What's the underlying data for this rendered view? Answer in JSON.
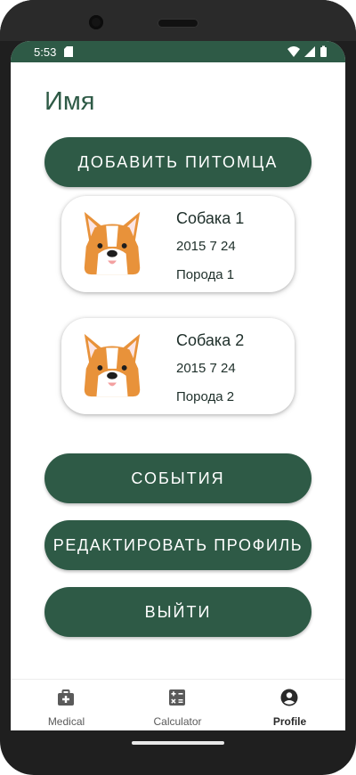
{
  "status_bar": {
    "time": "5:53"
  },
  "header": {
    "title": "Имя"
  },
  "actions": {
    "add_pet": "ДОБАВИТЬ ПИТОМЦА",
    "events": "СОБЫТИЯ",
    "edit_profile": "РЕДАКТИРОВАТЬ ПРОФИЛЬ",
    "logout": "ВЫЙТИ"
  },
  "pets": [
    {
      "name": "Собака 1",
      "birthdate": "2015 7 24",
      "breed": "Порода 1",
      "avatar": "corgi-icon"
    },
    {
      "name": "Собака 2",
      "birthdate": "2015 7 24",
      "breed": "Порода 2",
      "avatar": "corgi-icon"
    }
  ],
  "bottom_nav": {
    "items": [
      {
        "label": "Medical",
        "icon": "medical-kit-icon",
        "active": false
      },
      {
        "label": "Calculator",
        "icon": "calculator-icon",
        "active": false
      },
      {
        "label": "Profile",
        "icon": "account-circle-icon",
        "active": true
      }
    ]
  },
  "colors": {
    "primary": "#2e5a46",
    "status_bar": "#2e5a46",
    "accent_orange": "#e8923a",
    "text_dark": "#1e2f2a"
  }
}
